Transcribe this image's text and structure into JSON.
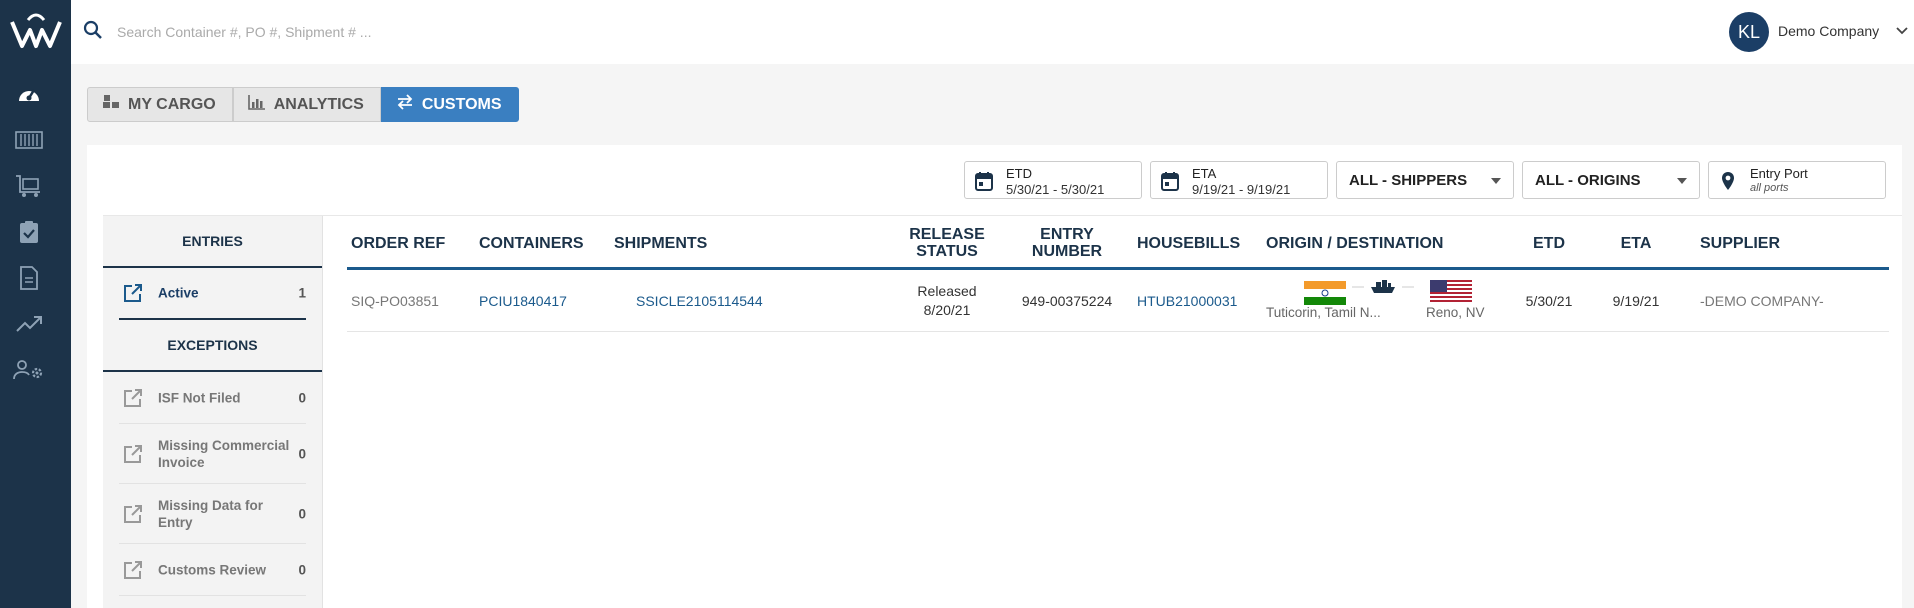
{
  "topbar": {
    "search_placeholder": "Search Container #, PO #, Shipment # ...",
    "avatar_initials": "KL",
    "company": "Demo Company"
  },
  "sidebar_rail": {
    "icons": [
      "dashboard-icon",
      "container-icon",
      "cart-icon",
      "clipboard-check-icon",
      "document-icon",
      "trend-icon",
      "users-settings-icon"
    ]
  },
  "tabs": [
    {
      "label": "MY CARGO",
      "icon": "pallet-icon",
      "active": false
    },
    {
      "label": "ANALYTICS",
      "icon": "bar-chart-icon",
      "active": false
    },
    {
      "label": "CUSTOMS",
      "icon": "exchange-icon",
      "active": true
    }
  ],
  "filters": {
    "etd": {
      "label": "ETD",
      "value": "5/30/21 - 5/30/21"
    },
    "eta": {
      "label": "ETA",
      "value": "9/19/21 - 9/19/21"
    },
    "shippers": "ALL - SHIPPERS",
    "origins": "ALL - ORIGINS",
    "entry_port": {
      "label": "Entry Port",
      "value": "all ports"
    }
  },
  "side": {
    "entries_header": "ENTRIES",
    "entries": [
      {
        "label": "Active",
        "count": "1"
      }
    ],
    "exceptions_header": "EXCEPTIONS",
    "exceptions": [
      {
        "label": "ISF Not Filed",
        "count": "0"
      },
      {
        "label": "Missing Commercial Invoice",
        "count": "0"
      },
      {
        "label": "Missing Data for Entry",
        "count": "0"
      },
      {
        "label": "Customs Review",
        "count": "0"
      }
    ]
  },
  "table": {
    "headers": {
      "order_ref": "ORDER REF",
      "containers": "CONTAINERS",
      "shipments": "SHIPMENTS",
      "release_status_1": "RELEASE",
      "release_status_2": "STATUS",
      "entry_number_1": "ENTRY",
      "entry_number_2": "NUMBER",
      "housebills": "HOUSEBILLS",
      "origin_destination": "ORIGIN / DESTINATION",
      "etd": "ETD",
      "eta": "ETA",
      "supplier": "SUPPLIER"
    },
    "rows": [
      {
        "order_ref": "SIQ-PO03851",
        "container": "PCIU1840417",
        "shipment": "SSICLE2105114544",
        "release_status": "Released",
        "release_date": "8/20/21",
        "entry_number": "949-00375224",
        "housebill": "HTUB21000031",
        "origin": "Tuticorin, Tamil N...",
        "destination": "Reno, NV",
        "etd": "5/30/21",
        "eta": "9/19/21",
        "supplier": "-DEMO COMPANY-"
      }
    ]
  },
  "colors": {
    "rail": "#1c3349",
    "accent": "#3a7fc1",
    "link": "#1b5a8c",
    "avatar": "#1b3e66"
  }
}
